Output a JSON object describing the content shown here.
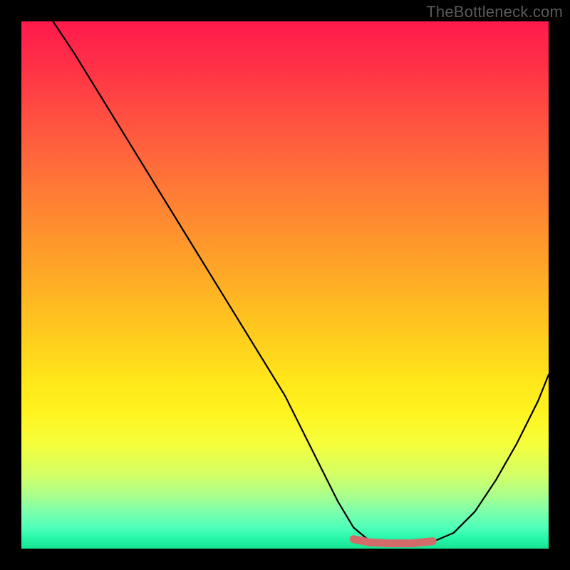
{
  "watermark": "TheBottleneck.com",
  "chart_data": {
    "type": "line",
    "title": "",
    "xlabel": "",
    "ylabel": "",
    "xlim": [
      0,
      100
    ],
    "ylim": [
      0,
      100
    ],
    "series": [
      {
        "name": "curve",
        "x": [
          6,
          10,
          18,
          26,
          34,
          42,
          50,
          56,
          60,
          63,
          66,
          70,
          74,
          78,
          82,
          86,
          90,
          94,
          98,
          100
        ],
        "y": [
          100,
          94,
          81,
          68,
          55,
          42,
          29,
          17,
          9,
          4,
          1.5,
          1,
          1,
          1.3,
          3,
          7,
          13,
          20,
          28,
          33
        ]
      },
      {
        "name": "highlight-segment",
        "x": [
          63,
          66,
          70,
          74,
          78
        ],
        "y": [
          1.8,
          1.2,
          1.0,
          1.0,
          1.4
        ]
      }
    ],
    "highlight_color": "#d46a6a",
    "curve_color": "#000000",
    "background_gradient": {
      "top": "#ff1a4d",
      "mid": "#ffe61a",
      "bottom": "#16e392"
    }
  }
}
